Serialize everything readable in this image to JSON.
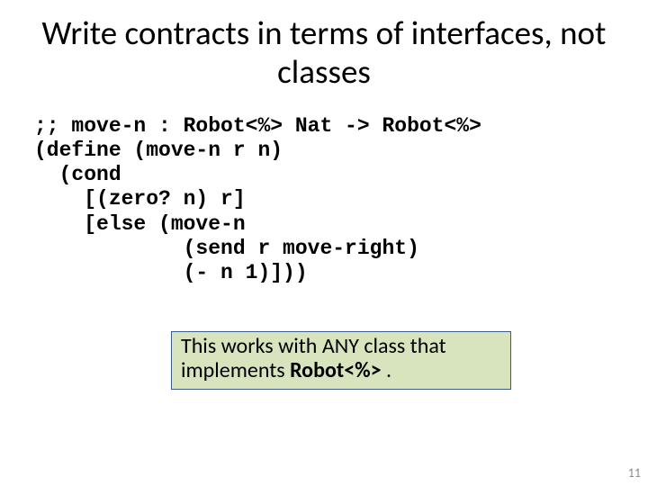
{
  "title": "Write contracts in terms of interfaces, not classes",
  "code": {
    "l1": ";; move-n : Robot<%> Nat -> Robot<%>",
    "l2": "(define (move-n r n)",
    "l3": "  (cond",
    "l4": "    [(zero? n) r]",
    "l5": "    [else (move-n",
    "l6": "            (send r move-right)",
    "l7": "            (- n 1)]))"
  },
  "callout": {
    "part1": "This works with ANY class that implements ",
    "bold": "Robot<%> ",
    "part2": "."
  },
  "page_number": "11"
}
